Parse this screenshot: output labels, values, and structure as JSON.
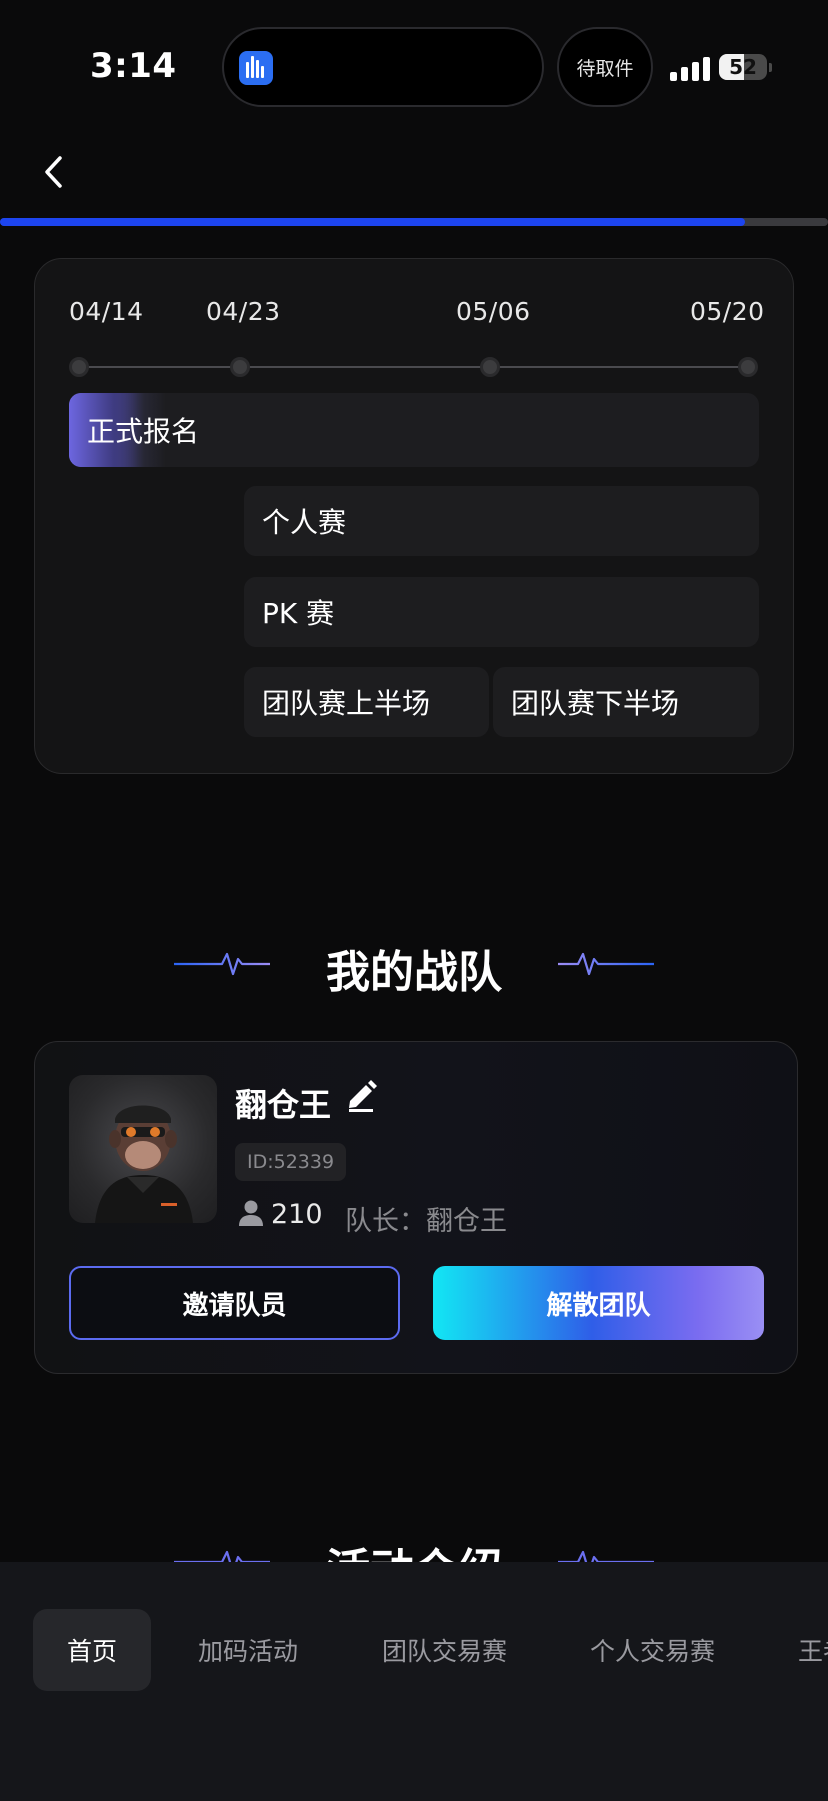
{
  "status_bar": {
    "time": "3:14",
    "pill_label": "待取件",
    "battery": "52",
    "battery_level": 0.52
  },
  "nav": {
    "progress": 0.9
  },
  "schedule": {
    "dates": [
      "04/14",
      "04/23",
      "05/06",
      "05/20"
    ],
    "rows": {
      "registration": "正式报名",
      "individual": "个人赛",
      "pk": "PK 赛",
      "team_first_half": "团队赛上半场",
      "team_second_half": "团队赛下半场"
    }
  },
  "my_team": {
    "section_title": "我的战队",
    "name": "翻仓王",
    "id": "ID:52339",
    "member_count": "210",
    "captain_label": "队长：",
    "captain_name": "翻仓王",
    "invite_button": "邀请队员",
    "disband_button": "解散团队"
  },
  "next_section": {
    "title": "活动介绍"
  },
  "tabs": [
    "首页",
    "加码活动",
    "团队交易赛",
    "个人交易赛",
    "王者"
  ]
}
